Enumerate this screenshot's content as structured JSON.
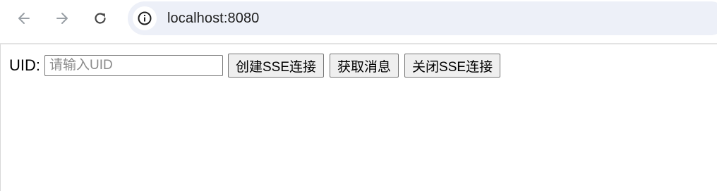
{
  "browser": {
    "url": "localhost:8080",
    "icons": {
      "back": "arrow-left-icon",
      "forward": "arrow-right-icon",
      "reload": "reload-icon",
      "site_info": "info-icon"
    },
    "colors": {
      "omnibox_bg": "#edf0f8",
      "icon_disabled": "#9aa0a6",
      "icon_active": "#474747"
    }
  },
  "page": {
    "uid_label": "UID:",
    "uid_input": {
      "value": "",
      "placeholder": "请输入UID"
    },
    "buttons": {
      "create": "创建SSE连接",
      "fetch": "获取消息",
      "close": "关闭SSE连接"
    }
  }
}
